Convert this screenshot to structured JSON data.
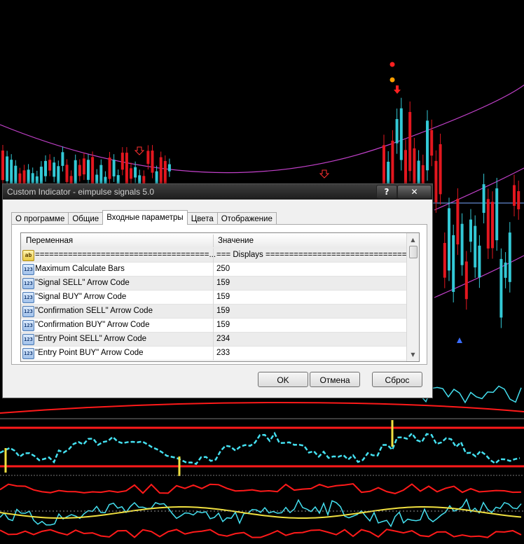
{
  "window": {
    "title": "Custom Indicator - eimpulse signals 5.0",
    "help_label": "?",
    "close_label": "✕"
  },
  "tabs": [
    {
      "label": "О программе",
      "active": false
    },
    {
      "label": "Общие",
      "active": false
    },
    {
      "label": "Входные параметры",
      "active": true
    },
    {
      "label": "Цвета",
      "active": false
    },
    {
      "label": "Отображение",
      "active": false
    }
  ],
  "grid": {
    "headers": {
      "variable": "Переменная",
      "value": "Значение"
    },
    "rows": [
      {
        "icon": "ab",
        "name": "=====================================...",
        "value": "=== Displays ===============================..."
      },
      {
        "icon": "123",
        "name": "Maximum Calculate Bars",
        "value": "250"
      },
      {
        "icon": "123",
        "name": "\"Signal SELL\" Arrow Code",
        "value": "159"
      },
      {
        "icon": "123",
        "name": "\"Signal BUY\" Arrow Code",
        "value": "159"
      },
      {
        "icon": "123",
        "name": "\"Confirmation SELL\" Arrow Code",
        "value": "159"
      },
      {
        "icon": "123",
        "name": "\"Confirmation BUY\" Arrow Code",
        "value": "159"
      },
      {
        "icon": "123",
        "name": "\"Entry Point SELL\" Arrow Code",
        "value": "234"
      },
      {
        "icon": "123",
        "name": "\"Entry Point BUY\" Arrow Code",
        "value": "233"
      }
    ]
  },
  "buttons": {
    "ok": "OK",
    "cancel": "Отмена",
    "reset": "Сброс"
  },
  "colors": {
    "background": "#000000",
    "bull_candle": "#33c9d6",
    "bear_candle": "#e3171f",
    "envelope": "#c040c8",
    "level_line": "#ff1a1a",
    "signal_line": "#44e0f0",
    "yellow_line": "#f0e040"
  }
}
